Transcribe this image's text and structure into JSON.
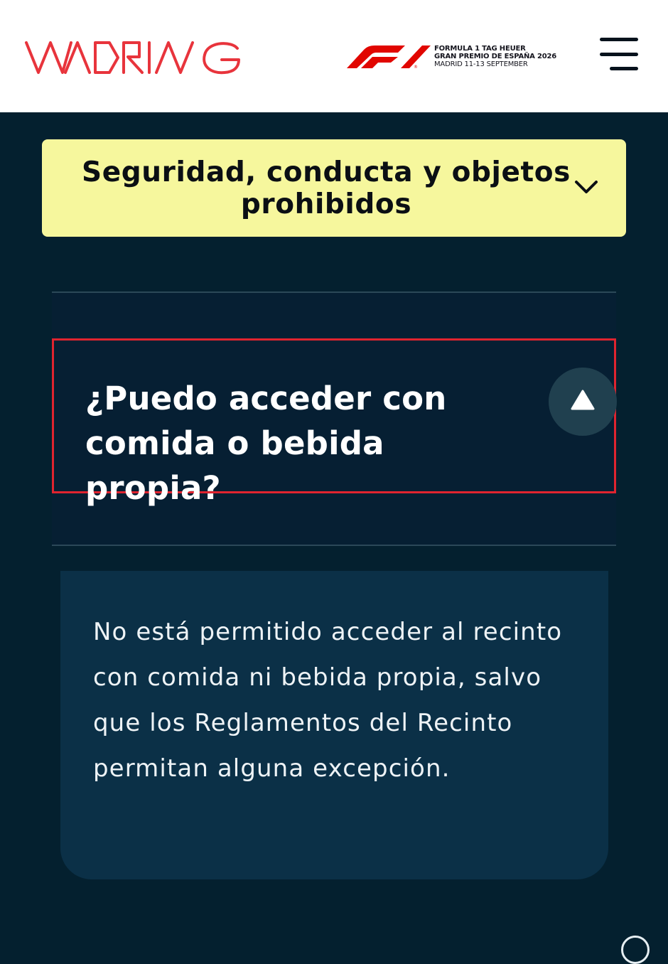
{
  "header": {
    "brand_logo_text": "MADRING",
    "event": {
      "line1": "FORMULA 1 TAG HEUER",
      "line2": "GRAN PREMIO DE ESPAÑA 2026",
      "line3": "MADRID 11-13 SEPTEMBER"
    },
    "icons": {
      "menu": "hamburger-menu-icon",
      "f1": "f1-logo-icon"
    },
    "colors": {
      "brand_red": "#e8343c",
      "header_bg": "#ffffff"
    }
  },
  "section": {
    "title": "Seguridad, conducta y objetos prohibidos",
    "icon": "chevron-down-icon",
    "bg_color": "#f6f79d"
  },
  "faq": {
    "question": "¿Puedo acceder con comida o bebida propia?",
    "toggle_icon": "triangle-up-icon",
    "expanded": true,
    "answer": "No está permitido acceder al recinto con comida ni bebida propia, salvo que los Reglamentos del Recinto permitan alguna excepción.",
    "highlight_color": "#e0242f"
  },
  "page": {
    "bg_color": "#04202f"
  }
}
